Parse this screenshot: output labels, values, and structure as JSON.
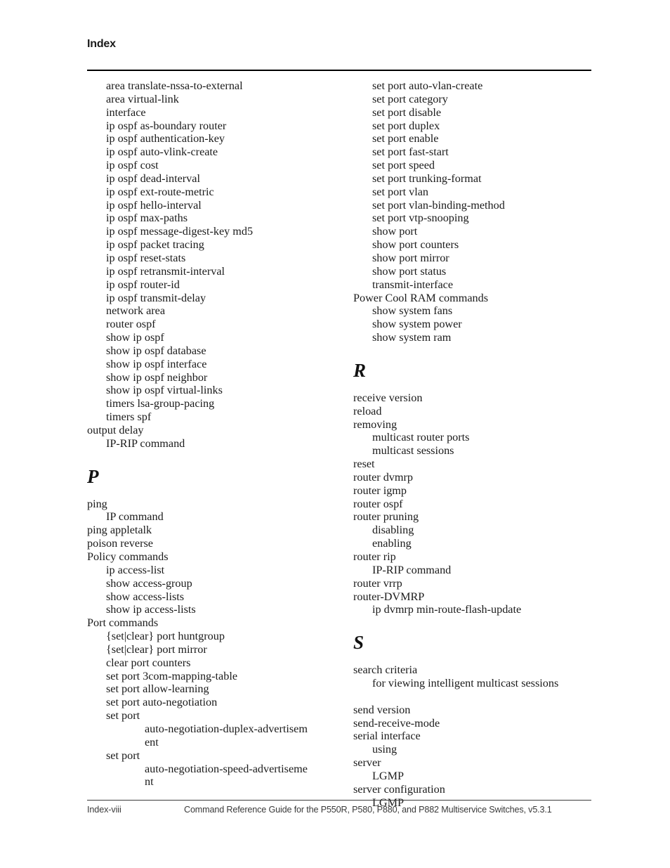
{
  "header": {
    "title": "Index"
  },
  "footer": {
    "page_label": "Index-viii",
    "document_title": "Command Reference Guide for the P550R, P580, P880, and P882 Multiservice Switches, v5.3.1"
  },
  "columns": {
    "left": [
      {
        "type": "entry",
        "level": 1,
        "text": "area translate-nssa-to-external"
      },
      {
        "type": "entry",
        "level": 1,
        "text": "area virtual-link"
      },
      {
        "type": "entry",
        "level": 1,
        "text": "interface"
      },
      {
        "type": "entry",
        "level": 1,
        "text": "ip ospf as-boundary router"
      },
      {
        "type": "entry",
        "level": 1,
        "text": "ip ospf authentication-key"
      },
      {
        "type": "entry",
        "level": 1,
        "text": "ip ospf auto-vlink-create"
      },
      {
        "type": "entry",
        "level": 1,
        "text": "ip ospf cost"
      },
      {
        "type": "entry",
        "level": 1,
        "text": "ip ospf dead-interval"
      },
      {
        "type": "entry",
        "level": 1,
        "text": "ip ospf ext-route-metric"
      },
      {
        "type": "entry",
        "level": 1,
        "text": "ip ospf hello-interval"
      },
      {
        "type": "entry",
        "level": 1,
        "text": "ip ospf max-paths"
      },
      {
        "type": "entry",
        "level": 1,
        "text": "ip ospf message-digest-key md5"
      },
      {
        "type": "entry",
        "level": 1,
        "text": "ip ospf packet tracing"
      },
      {
        "type": "entry",
        "level": 1,
        "text": "ip ospf reset-stats"
      },
      {
        "type": "entry",
        "level": 1,
        "text": "ip ospf retransmit-interval"
      },
      {
        "type": "entry",
        "level": 1,
        "text": "ip ospf router-id"
      },
      {
        "type": "entry",
        "level": 1,
        "text": "ip ospf transmit-delay"
      },
      {
        "type": "entry",
        "level": 1,
        "text": "network area"
      },
      {
        "type": "entry",
        "level": 1,
        "text": "router ospf"
      },
      {
        "type": "entry",
        "level": 1,
        "text": "show ip ospf"
      },
      {
        "type": "entry",
        "level": 1,
        "text": "show ip ospf database"
      },
      {
        "type": "entry",
        "level": 1,
        "text": "show ip ospf interface"
      },
      {
        "type": "entry",
        "level": 1,
        "text": "show ip ospf neighbor"
      },
      {
        "type": "entry",
        "level": 1,
        "text": "show ip ospf virtual-links"
      },
      {
        "type": "entry",
        "level": 1,
        "text": "timers lsa-group-pacing"
      },
      {
        "type": "entry",
        "level": 1,
        "text": "timers spf"
      },
      {
        "type": "entry",
        "level": 0,
        "text": "output delay"
      },
      {
        "type": "entry",
        "level": 1,
        "text": "IP-RIP command"
      },
      {
        "type": "letter",
        "text": "P"
      },
      {
        "type": "entry",
        "level": 0,
        "text": "ping"
      },
      {
        "type": "entry",
        "level": 1,
        "text": "IP command"
      },
      {
        "type": "entry",
        "level": 0,
        "text": "ping appletalk"
      },
      {
        "type": "entry",
        "level": 0,
        "text": "poison reverse"
      },
      {
        "type": "entry",
        "level": 0,
        "text": "Policy commands"
      },
      {
        "type": "entry",
        "level": 1,
        "text": "ip access-list"
      },
      {
        "type": "entry",
        "level": 1,
        "text": "show access-group"
      },
      {
        "type": "entry",
        "level": 1,
        "text": "show access-lists"
      },
      {
        "type": "entry",
        "level": 1,
        "text": "show ip access-lists"
      },
      {
        "type": "entry",
        "level": 0,
        "text": "Port commands"
      },
      {
        "type": "entry",
        "level": 1,
        "text": "{set|clear} port huntgroup"
      },
      {
        "type": "entry",
        "level": 1,
        "text": "{set|clear} port mirror"
      },
      {
        "type": "entry",
        "level": 1,
        "text": "clear port counters"
      },
      {
        "type": "entry",
        "level": 1,
        "text": "set port 3com-mapping-table"
      },
      {
        "type": "entry",
        "level": 1,
        "text": "set port allow-learning"
      },
      {
        "type": "entry",
        "level": 1,
        "text": "set port auto-negotiation"
      },
      {
        "type": "entry",
        "level": 1,
        "text": "set port"
      },
      {
        "type": "entry",
        "level": 2,
        "text": "auto-negotiation-duplex-advertisem\nent"
      },
      {
        "type": "entry",
        "level": 1,
        "text": "set port"
      },
      {
        "type": "entry",
        "level": 2,
        "text": "auto-negotiation-speed-advertiseme\nnt"
      }
    ],
    "right": [
      {
        "type": "entry",
        "level": 1,
        "text": "set port auto-vlan-create"
      },
      {
        "type": "entry",
        "level": 1,
        "text": "set port category"
      },
      {
        "type": "entry",
        "level": 1,
        "text": "set port disable"
      },
      {
        "type": "entry",
        "level": 1,
        "text": "set port duplex"
      },
      {
        "type": "entry",
        "level": 1,
        "text": "set port enable"
      },
      {
        "type": "entry",
        "level": 1,
        "text": "set port fast-start"
      },
      {
        "type": "entry",
        "level": 1,
        "text": "set port speed"
      },
      {
        "type": "entry",
        "level": 1,
        "text": "set port trunking-format"
      },
      {
        "type": "entry",
        "level": 1,
        "text": "set port vlan"
      },
      {
        "type": "entry",
        "level": 1,
        "text": "set port vlan-binding-method"
      },
      {
        "type": "entry",
        "level": 1,
        "text": "set port vtp-snooping"
      },
      {
        "type": "entry",
        "level": 1,
        "text": "show port"
      },
      {
        "type": "entry",
        "level": 1,
        "text": "show port counters"
      },
      {
        "type": "entry",
        "level": 1,
        "text": "show port mirror"
      },
      {
        "type": "entry",
        "level": 1,
        "text": "show port status"
      },
      {
        "type": "entry",
        "level": 1,
        "text": "transmit-interface"
      },
      {
        "type": "entry",
        "level": 0,
        "text": "Power Cool RAM commands"
      },
      {
        "type": "entry",
        "level": 1,
        "text": "show system fans"
      },
      {
        "type": "entry",
        "level": 1,
        "text": "show system power"
      },
      {
        "type": "entry",
        "level": 1,
        "text": "show system ram"
      },
      {
        "type": "letter",
        "text": "R"
      },
      {
        "type": "entry",
        "level": 0,
        "text": "receive version"
      },
      {
        "type": "entry",
        "level": 0,
        "text": "reload"
      },
      {
        "type": "entry",
        "level": 0,
        "text": "removing"
      },
      {
        "type": "entry",
        "level": 1,
        "text": "multicast router ports"
      },
      {
        "type": "entry",
        "level": 1,
        "text": "multicast sessions"
      },
      {
        "type": "entry",
        "level": 0,
        "text": "reset"
      },
      {
        "type": "entry",
        "level": 0,
        "text": "router dvmrp"
      },
      {
        "type": "entry",
        "level": 0,
        "text": "router igmp"
      },
      {
        "type": "entry",
        "level": 0,
        "text": "router ospf"
      },
      {
        "type": "entry",
        "level": 0,
        "text": "router pruning"
      },
      {
        "type": "entry",
        "level": 1,
        "text": "disabling"
      },
      {
        "type": "entry",
        "level": 1,
        "text": "enabling"
      },
      {
        "type": "entry",
        "level": 0,
        "text": "router rip"
      },
      {
        "type": "entry",
        "level": 1,
        "text": "IP-RIP command"
      },
      {
        "type": "entry",
        "level": 0,
        "text": "router vrrp"
      },
      {
        "type": "entry",
        "level": 0,
        "text": "router-DVMRP"
      },
      {
        "type": "entry",
        "level": 1,
        "text": "ip dvmrp min-route-flash-update"
      },
      {
        "type": "letter",
        "text": "S"
      },
      {
        "type": "entry",
        "level": 0,
        "text": "search criteria"
      },
      {
        "type": "entry",
        "level": 1,
        "text": "for viewing intelligent multicast sessions"
      },
      {
        "type": "spacer"
      },
      {
        "type": "entry",
        "level": 0,
        "text": "send version"
      },
      {
        "type": "entry",
        "level": 0,
        "text": "send-receive-mode"
      },
      {
        "type": "entry",
        "level": 0,
        "text": "serial interface"
      },
      {
        "type": "entry",
        "level": 1,
        "text": "using"
      },
      {
        "type": "entry",
        "level": 0,
        "text": "server"
      },
      {
        "type": "entry",
        "level": 1,
        "text": "LGMP"
      },
      {
        "type": "entry",
        "level": 0,
        "text": "server configuration"
      },
      {
        "type": "entry",
        "level": 1,
        "text": "LGMP"
      }
    ]
  }
}
